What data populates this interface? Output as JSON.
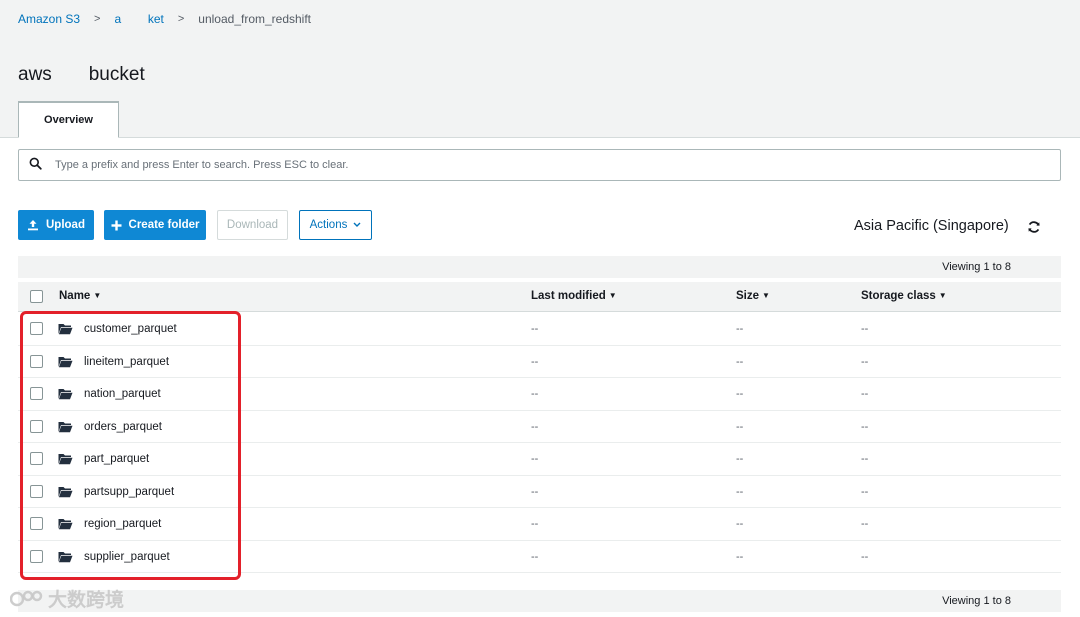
{
  "breadcrumb": {
    "root": "Amazon S3",
    "bucket": "a        ket",
    "current": "unload_from_redshift",
    "separator": ">"
  },
  "bucket_title": "aws       bucket",
  "tabs": [
    {
      "label": "Overview",
      "active": true
    }
  ],
  "search": {
    "placeholder": "Type a prefix and press Enter to search. Press ESC to clear.",
    "value": ""
  },
  "toolbar": {
    "upload_label": "Upload",
    "create_folder_label": "Create folder",
    "download_label": "Download",
    "actions_label": "Actions"
  },
  "region": "Asia Pacific (Singapore)",
  "viewing_text": "Viewing 1 to 8",
  "columns": {
    "name": "Name",
    "last_modified": "Last modified",
    "size": "Size",
    "storage_class": "Storage class"
  },
  "rows": [
    {
      "name": "customer_parquet",
      "last_modified": "--",
      "size": "--",
      "storage_class": "--"
    },
    {
      "name": "lineitem_parquet",
      "last_modified": "--",
      "size": "--",
      "storage_class": "--"
    },
    {
      "name": "nation_parquet",
      "last_modified": "--",
      "size": "--",
      "storage_class": "--"
    },
    {
      "name": "orders_parquet",
      "last_modified": "--",
      "size": "--",
      "storage_class": "--"
    },
    {
      "name": "part_parquet",
      "last_modified": "--",
      "size": "--",
      "storage_class": "--"
    },
    {
      "name": "partsupp_parquet",
      "last_modified": "--",
      "size": "--",
      "storage_class": "--"
    },
    {
      "name": "region_parquet",
      "last_modified": "--",
      "size": "--",
      "storage_class": "--"
    },
    {
      "name": "supplier_parquet",
      "last_modified": "--",
      "size": "--",
      "storage_class": "--"
    }
  ],
  "watermark": "大数跨境",
  "colors": {
    "link": "#0073bb",
    "primary_button": "#0f88d4",
    "highlight": "#e3202a"
  },
  "icons": [
    "search-icon",
    "upload-icon",
    "plus-icon",
    "chevron-down-icon",
    "refresh-icon",
    "folder-icon"
  ]
}
